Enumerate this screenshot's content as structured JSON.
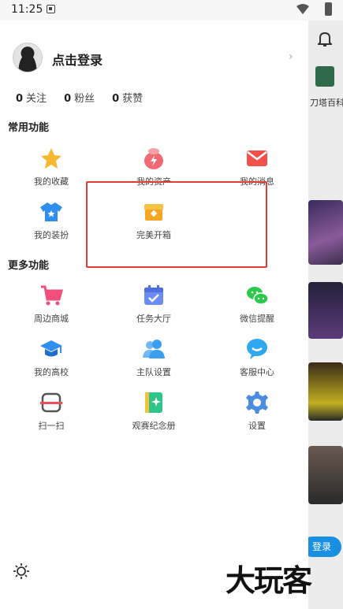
{
  "status_bar": {
    "time": "11:25"
  },
  "profile": {
    "login_label": "点击登录",
    "chevron": "›"
  },
  "stats": [
    {
      "value": "0",
      "label": "关注"
    },
    {
      "value": "0",
      "label": "粉丝"
    },
    {
      "value": "0",
      "label": "获赞"
    }
  ],
  "common_features": {
    "title": "常用功能",
    "items": [
      {
        "label": "我的收藏",
        "icon": "star-icon",
        "color": "#f5b82e"
      },
      {
        "label": "我的资产",
        "icon": "wallet-bag-icon",
        "color": "#f06a74"
      },
      {
        "label": "我的消息",
        "icon": "envelope-icon",
        "color": "#f2504b"
      },
      {
        "label": "我的装扮",
        "icon": "tshirt-icon",
        "color": "#2f8ff0"
      },
      {
        "label": "完美开箱",
        "icon": "treasure-box-icon",
        "color": "#f5a623"
      }
    ]
  },
  "more_features": {
    "title": "更多功能",
    "items": [
      {
        "label": "周边商城",
        "icon": "shopping-cart-icon",
        "color": "#ef4f7a"
      },
      {
        "label": "任务大厅",
        "icon": "calendar-check-icon",
        "color": "#6b8cf2"
      },
      {
        "label": "微信提醒",
        "icon": "wechat-icon",
        "color": "#2dc94d"
      },
      {
        "label": "我的高校",
        "icon": "graduation-cap-icon",
        "color": "#2f8ff0"
      },
      {
        "label": "主队设置",
        "icon": "team-people-icon",
        "color": "#3a9ff0"
      },
      {
        "label": "客服中心",
        "icon": "chat-bubble-icon",
        "color": "#2fa8f0"
      },
      {
        "label": "扫一扫",
        "icon": "scan-icon",
        "color": "#ef4f5a"
      },
      {
        "label": "观赛纪念册",
        "icon": "album-sparkle-icon",
        "color": "#2ec48a"
      },
      {
        "label": "设置",
        "icon": "gear-icon",
        "color": "#4a8de0"
      }
    ]
  },
  "background_app": {
    "dota_label": "刀塔百科",
    "login_button": "登录"
  },
  "watermark": "大玩客"
}
